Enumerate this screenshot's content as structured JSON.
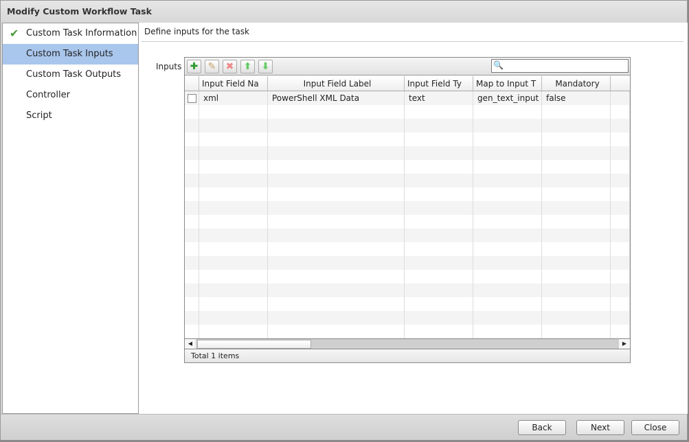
{
  "window": {
    "title": "Modify Custom Workflow Task"
  },
  "sidebar": {
    "items": [
      {
        "label": "Custom Task Information",
        "completed": true
      },
      {
        "label": "Custom Task Inputs",
        "selected": true
      },
      {
        "label": "Custom Task Outputs"
      },
      {
        "label": "Controller"
      },
      {
        "label": "Script"
      }
    ]
  },
  "main": {
    "heading": "Define inputs for the task",
    "inputs_label": "Inputs"
  },
  "grid": {
    "toolbar": {
      "add": "add-icon",
      "edit": "pencil-icon",
      "delete": "delete-icon",
      "up": "arrow-up-icon",
      "down": "arrow-down-icon",
      "search_value": ""
    },
    "columns": [
      "Input Field Na",
      "Input Field Label",
      "Input Field Ty",
      "Map to Input T",
      "Mandatory"
    ],
    "rows": [
      {
        "name": "xml",
        "label": "PowerShell XML Data",
        "type": "text",
        "map": "gen_text_input",
        "mandatory": "false"
      }
    ],
    "footer": "Total 1 items"
  },
  "buttons": {
    "back": "Back",
    "next": "Next",
    "close": "Close"
  }
}
